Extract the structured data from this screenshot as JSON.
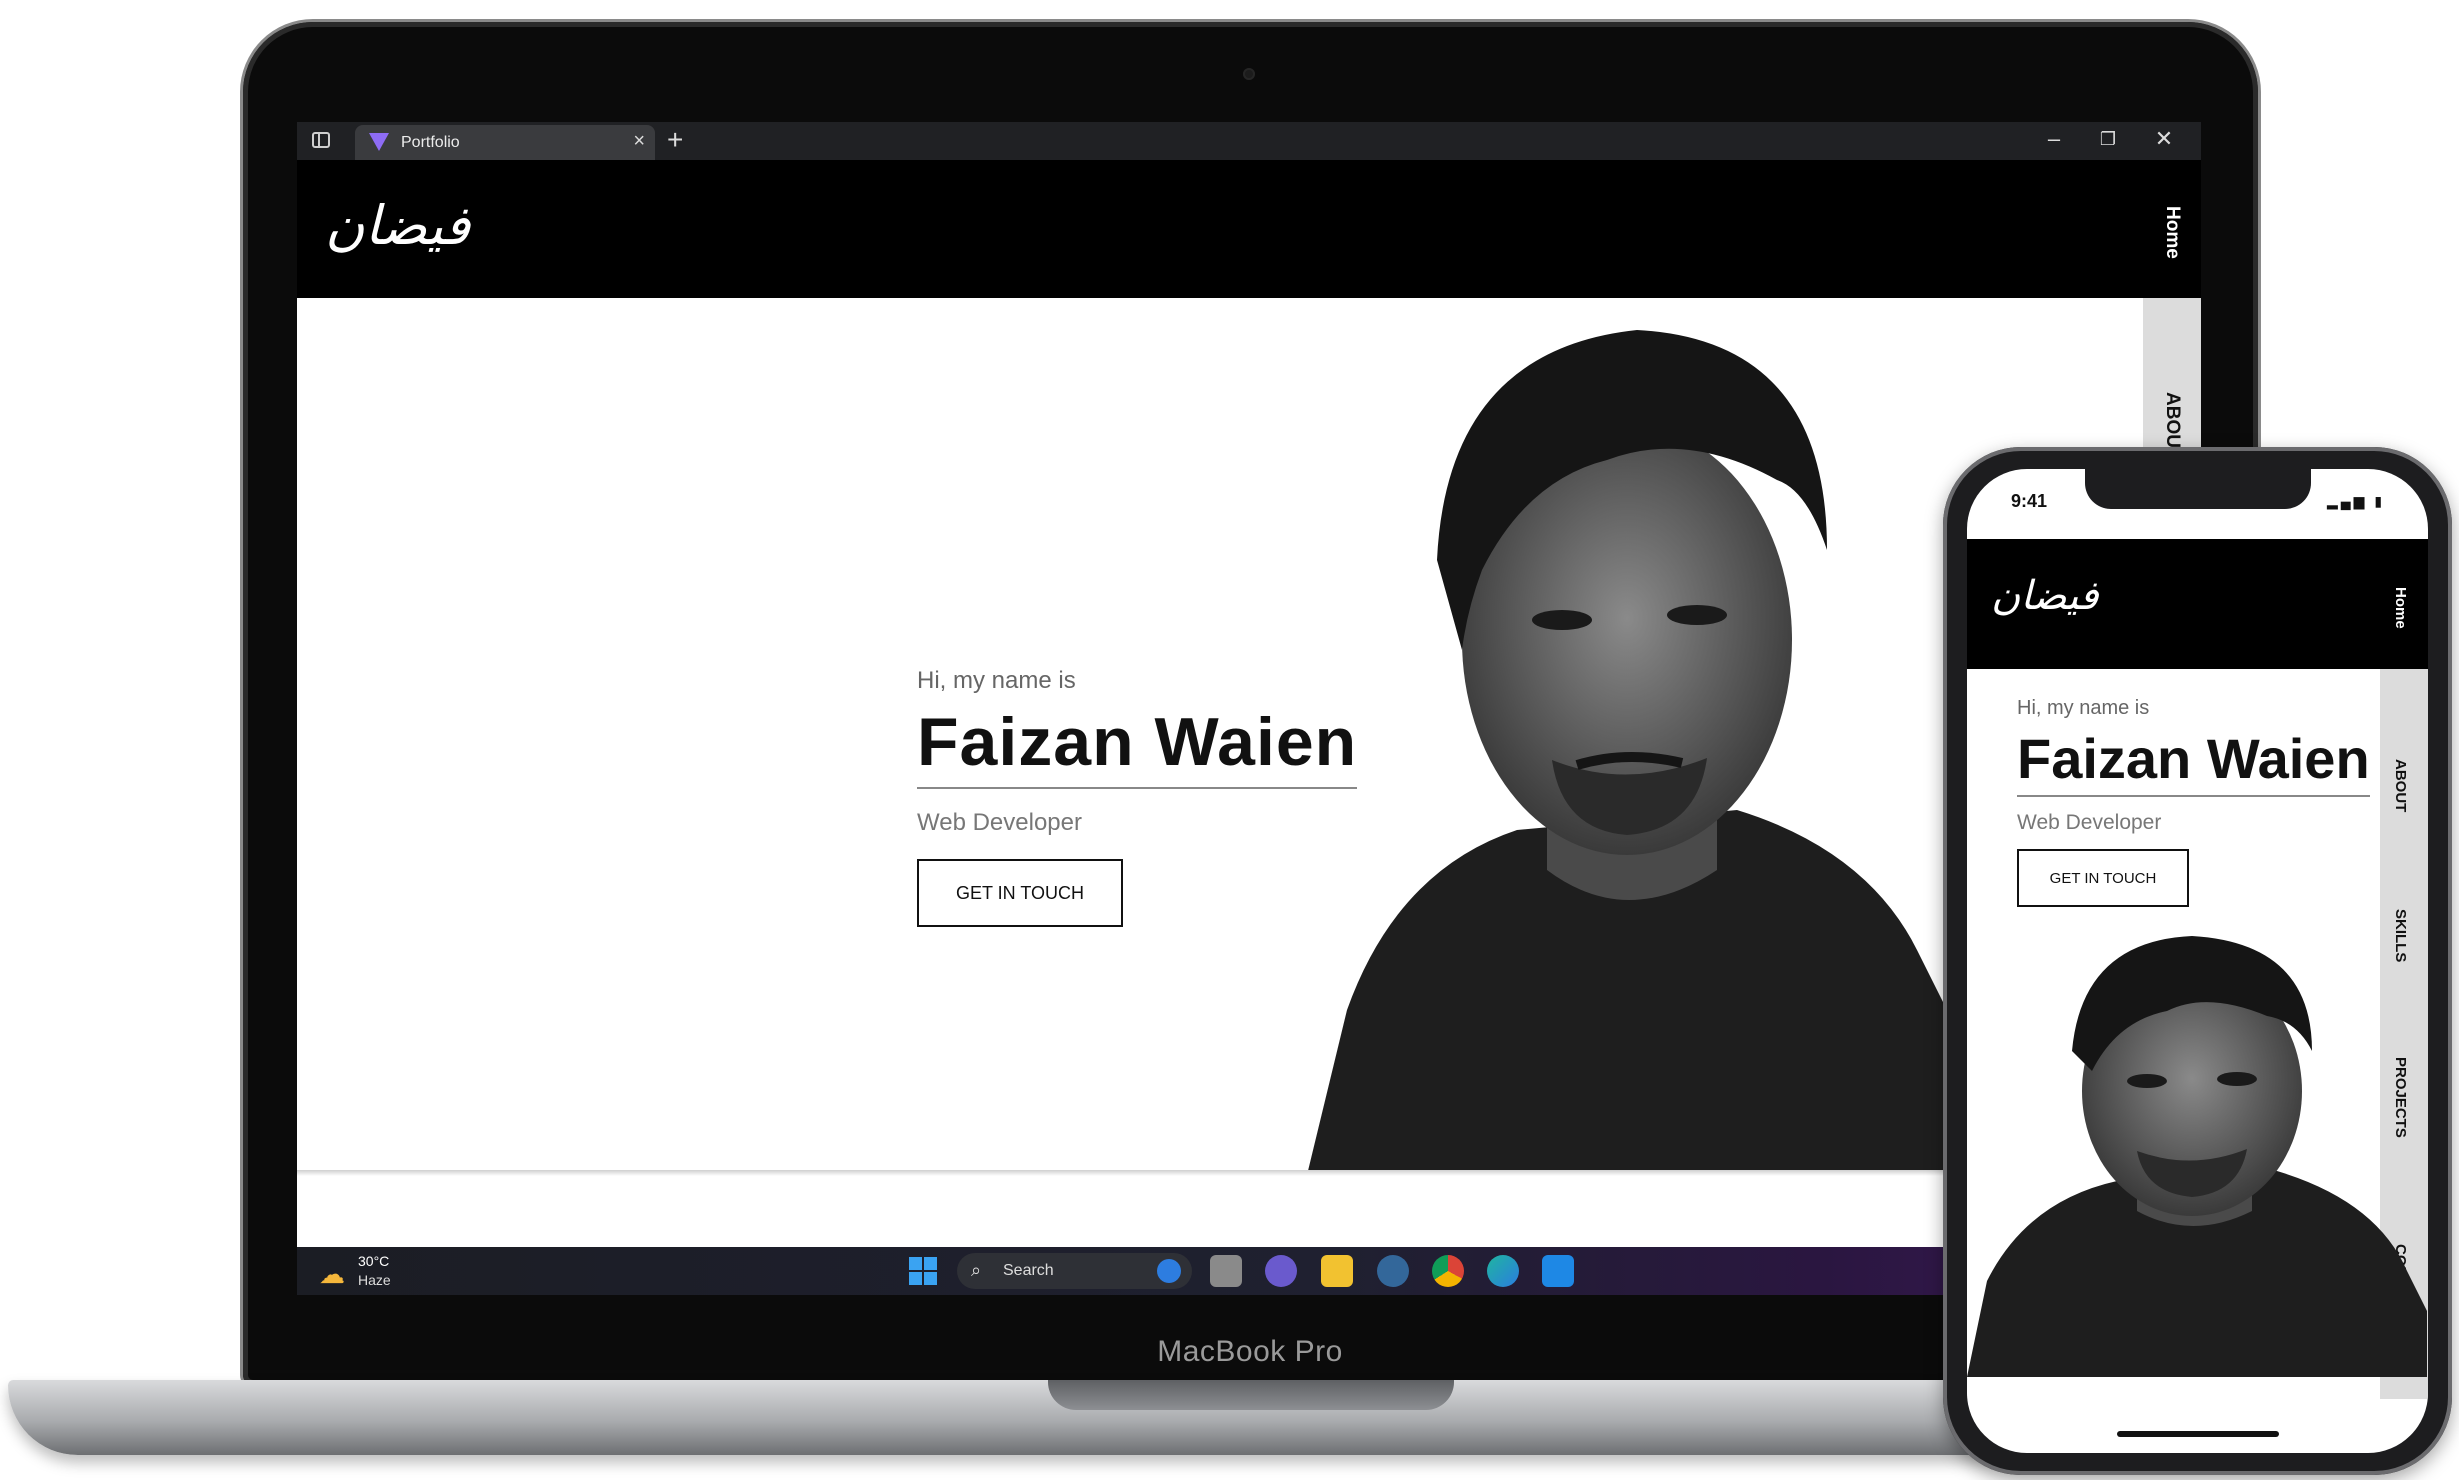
{
  "laptop": {
    "brand_label": "MacBook Pro"
  },
  "browser": {
    "tab_title": "Portfolio",
    "close_tab_glyph": "×",
    "new_tab_glyph": "+",
    "minimize_glyph": "–",
    "restore_glyph": "❐",
    "close_window_glyph": "✕"
  },
  "site": {
    "logo": "فیضان",
    "nav": {
      "home": "Home",
      "about": "ABOUT",
      "skills": "SKILLS",
      "projects": "PROJECTS",
      "contact": "CONTACT"
    },
    "hero": {
      "greeting": "Hi, my name is",
      "name": "Faizan Waien",
      "role": "Web Developer",
      "cta_label": "GET IN TOUCH"
    }
  },
  "taskbar": {
    "weather_temp": "30°C",
    "weather_condition": "Haze",
    "search_placeholder": "Search",
    "apps": [
      "windows-start-icon",
      "search-box",
      "bing-icon",
      "task-view-icon",
      "teams-icon",
      "file-explorer-icon",
      "postgres-icon",
      "chrome-icon",
      "edge-icon",
      "vscode-icon"
    ]
  },
  "phone": {
    "time": "9:41"
  },
  "colors": {
    "header_bg": "#000000",
    "nav_strip": "#dcdcdc",
    "accent_text": "#111111",
    "muted_text": "#777777"
  }
}
